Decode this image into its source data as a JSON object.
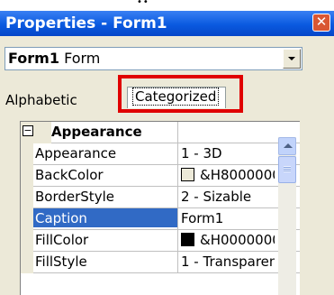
{
  "window": {
    "title": "Properties - Form1",
    "close_glyph": "✕"
  },
  "object_selector": {
    "name": "Form1",
    "type": "Form"
  },
  "tabs": [
    {
      "label": "Alphabetic",
      "selected": false
    },
    {
      "label": "Categorized",
      "selected": true
    }
  ],
  "grid": {
    "category": {
      "label": "Appearance",
      "expander": "⊟"
    },
    "rows": [
      {
        "name": "Appearance",
        "value": "1 - 3D"
      },
      {
        "name": "BackColor",
        "value": "&H8000000",
        "swatch_color": "#ece9d8"
      },
      {
        "name": "BorderStyle",
        "value": "2 - Sizable"
      },
      {
        "name": "Caption",
        "value": "Form1",
        "selected": true
      },
      {
        "name": "FillColor",
        "value": "&H0000000",
        "swatch_color": "#000000"
      },
      {
        "name": "FillStyle",
        "value": "1 - Transparen"
      }
    ]
  },
  "colors": {
    "titlebar": "#0a5ae0",
    "selection": "#316ac5",
    "highlight_box": "#e00000"
  }
}
